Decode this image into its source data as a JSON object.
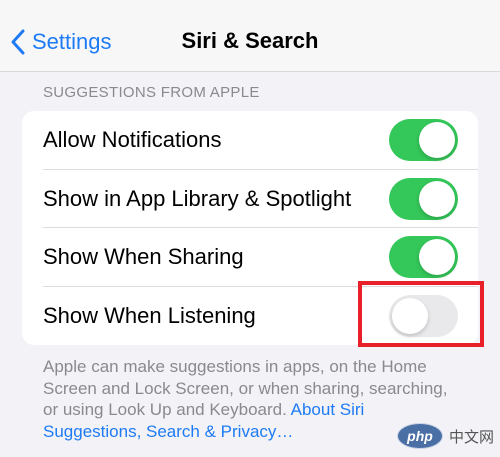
{
  "nav": {
    "back_label": "Settings",
    "title": "Siri & Search"
  },
  "section": {
    "header": "SUGGESTIONS FROM APPLE",
    "rows": [
      {
        "label": "Allow Notifications",
        "toggle": "on"
      },
      {
        "label": "Show in App Library & Spotlight",
        "toggle": "on"
      },
      {
        "label": "Show When Sharing",
        "toggle": "on"
      },
      {
        "label": "Show When Listening",
        "toggle": "off"
      }
    ]
  },
  "footer": {
    "text": "Apple can make suggestions in apps, on the Home Screen and Lock Screen, or when sharing, searching, or using Look Up and Keyboard. ",
    "link": "About Siri Suggestions, Search & Privacy…"
  },
  "watermark": {
    "logo_text": "php",
    "site_text": "中文网"
  },
  "colors": {
    "accent": "#1e7bf5",
    "toggle_on": "#34c759",
    "toggle_off": "#e9e9eb",
    "highlight": "#e8202a"
  }
}
